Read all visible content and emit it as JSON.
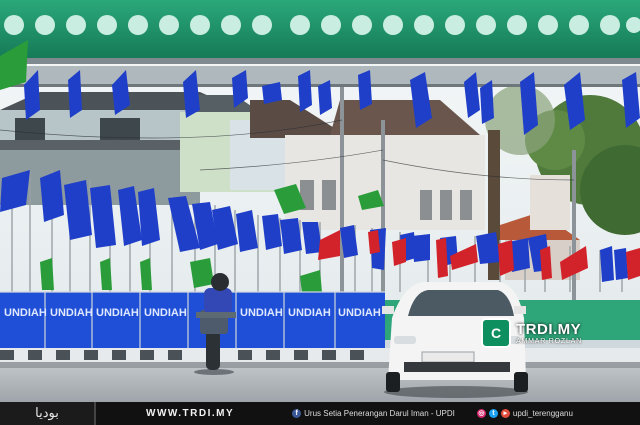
{
  "watermark": {
    "badge": "C",
    "brand": "TRDI.MY",
    "credit": "AMMAR ROZLAN"
  },
  "footer": {
    "logo_text": "بوديا",
    "website": "WWW.TRDI.MY",
    "facebook_text": "Urus Setia Penerangan Darul Iman - UPDI",
    "social_handle": "updi_terengganu"
  },
  "banner_text": "UNDIAH",
  "colors": {
    "sky": "#f3f6f7",
    "canopy": "#1d9a6e",
    "flag_blue": "#1f3fc9",
    "flag_green": "#2a9d3a",
    "barrier_blue": "#1e4fd6",
    "barrier_green": "#2fa67a",
    "road": "#b9bec3",
    "car": "#f4f4f4"
  }
}
